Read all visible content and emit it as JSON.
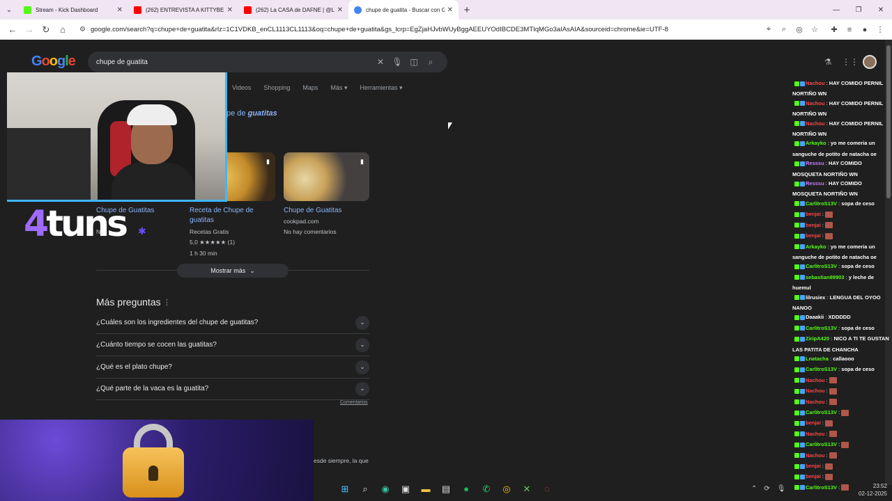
{
  "tabs": [
    {
      "title": "Stream - Kick Dashboard",
      "favicon_color": "#53fc18"
    },
    {
      "title": "(262) ENTREVISTA A KITTYBELL",
      "favicon_color": "#ff0000"
    },
    {
      "title": "(262) La CASA de DAFNE | @Lu",
      "favicon_color": "#ff0000"
    },
    {
      "title": "chupe de guatita - Buscar con G",
      "favicon_color": "#4285f4"
    }
  ],
  "toolbar": {
    "url": "google.com/search?q=chupe+de+guatita&rlz=1C1VDKB_enCL1113CL1113&oq=chupe+de+guatita&gs_lcrp=EgZjaHJvbWUyBggAEEUYOdIBCDE3MTIqMGo3aIAsAIA&sourceid=chrome&ie=UTF-8"
  },
  "search": {
    "logo": "Google",
    "query": "chupe de guatita",
    "filters": [
      "Videos",
      "Shopping",
      "Maps",
      "Más",
      "Herramientas"
    ]
  },
  "recipes": {
    "heading_prefix": "pe de",
    "heading_em": "guatitas",
    "cards": [
      {
        "title": "Chupe de Guatitas",
        "source": "",
        "rating": "",
        "time": "",
        "extra": "No"
      },
      {
        "title": "Receta de Chupe de guatitas",
        "source": "Recetas Gratis",
        "rating": "5,0 ★★★★★ (1)",
        "time": "1 h 30 min"
      },
      {
        "title": "Chupe de Guatitas",
        "source": "cookpad.com",
        "rating": "",
        "time": "No hay comentarios"
      }
    ],
    "show_more": "Mostrar más"
  },
  "paa": {
    "title": "Más preguntas",
    "questions": [
      "¿Cuáles son los ingredientes del chupe de guatitas?",
      "¿Cuánto tiempo se cocen las guatitas?",
      "¿Qué es el plato chupe?",
      "¿Qué parte de la vaca es la guatita?"
    ],
    "feedback": "Comentarios"
  },
  "snippet": "esde siempre, la que",
  "overlay": {
    "brand_four": "4",
    "brand_rest": "tuns"
  },
  "chat": [
    {
      "user": "Nachou",
      "color": "#ff4444",
      "msg": "HAY COMIDO PERNIL NORTIÑO WN",
      "wrap": true
    },
    {
      "user": "Nachou",
      "color": "#ff4444",
      "msg": "HAY COMIDO PERNIL NORTIÑO WN",
      "wrap": true
    },
    {
      "user": "Nachou",
      "color": "#ff4444",
      "msg": "HAY COMIDO PERNIL NORTIÑO WN",
      "wrap": true
    },
    {
      "user": "Arkayko",
      "color": "#53fc18",
      "msg": "yo me comeria un sanguche de potito de natacha oe",
      "wrap": true
    },
    {
      "user": "Resssu",
      "color": "#c77dff",
      "msg": "HAY COMIDO MOSQUETA NORTIÑO WN",
      "wrap": true
    },
    {
      "user": "Resssu",
      "color": "#c77dff",
      "msg": "HAY COMIDO MOSQUETA NORTIÑO WN",
      "wrap": true
    },
    {
      "user": "CarlitroS13V",
      "color": "#53fc18",
      "msg": "sopa de ceso",
      "wrap": false
    },
    {
      "user": "benjai",
      "color": "#ff4444",
      "msg": "",
      "wrap": false
    },
    {
      "user": "benjai",
      "color": "#ff4444",
      "msg": "",
      "wrap": false
    },
    {
      "user": "benjai",
      "color": "#ff4444",
      "msg": "",
      "wrap": false
    },
    {
      "user": "Arkayko",
      "color": "#53fc18",
      "msg": "yo me comeria un sanguche de potito de natacha oe",
      "wrap": true
    },
    {
      "user": "CarlitroS13V",
      "color": "#53fc18",
      "msg": "sopa de ceso",
      "wrap": false
    },
    {
      "user": "sebastian89903",
      "color": "#53fc18",
      "msg": "y leche de huemul",
      "wrap": true
    },
    {
      "user": "lilrusiex",
      "color": "#ffffff",
      "msg": "LENGUA DEL OYOO NANOO",
      "wrap": true
    },
    {
      "user": "Daaakii",
      "color": "#ffffff",
      "msg": "XDDDDD",
      "wrap": false
    },
    {
      "user": "CarlitroS13V",
      "color": "#53fc18",
      "msg": "sopa de ceso",
      "wrap": false
    },
    {
      "user": "ZiripA420",
      "color": "#53fc18",
      "msg": "NICO A TI TE GUSTAN LAS PATITA DE CHANCHA",
      "wrap": true
    },
    {
      "user": "Lnatacha",
      "color": "#53fc18",
      "msg": "callaooo",
      "wrap": false
    },
    {
      "user": "CarlitroS13V",
      "color": "#53fc18",
      "msg": "sopa de ceso",
      "wrap": false
    },
    {
      "user": "Nachou",
      "color": "#ff4444",
      "msg": "",
      "wrap": false
    },
    {
      "user": "Nachou",
      "color": "#ff4444",
      "msg": "",
      "wrap": false
    },
    {
      "user": "Nachou",
      "color": "#ff4444",
      "msg": "",
      "wrap": false
    },
    {
      "user": "CarlitroS13V",
      "color": "#53fc18",
      "msg": "",
      "wrap": false
    },
    {
      "user": "benjai",
      "color": "#ff4444",
      "msg": "",
      "wrap": false
    },
    {
      "user": "Nachou",
      "color": "#ff4444",
      "msg": "",
      "wrap": false
    },
    {
      "user": "CarlitroS13V",
      "color": "#53fc18",
      "msg": "",
      "wrap": false
    },
    {
      "user": "Nachou",
      "color": "#ff4444",
      "msg": "",
      "wrap": false
    },
    {
      "user": "benjai",
      "color": "#ff4444",
      "msg": "",
      "wrap": false
    },
    {
      "user": "benjai",
      "color": "#ff4444",
      "msg": "",
      "wrap": false
    },
    {
      "user": "CarlitroS13V",
      "color": "#53fc18",
      "msg": "",
      "wrap": false
    }
  ],
  "clock": {
    "time": "23:52",
    "date": "02-12-2025"
  }
}
